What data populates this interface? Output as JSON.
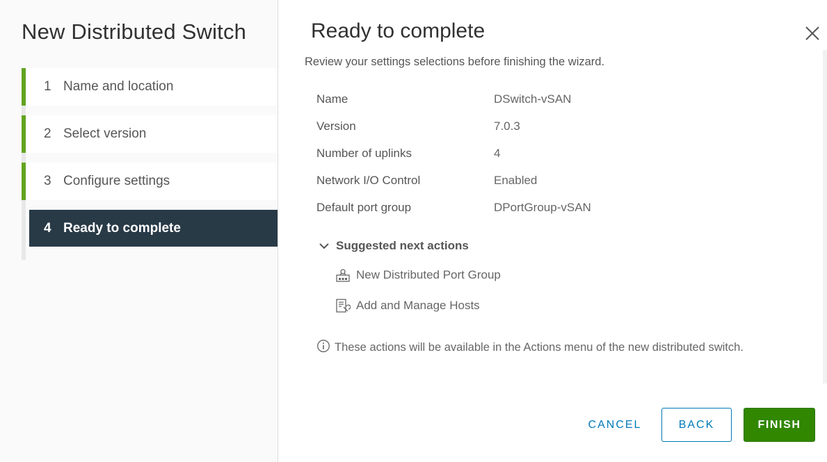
{
  "wizard": {
    "title": "New Distributed Switch",
    "steps": [
      {
        "num": "1",
        "label": "Name and location"
      },
      {
        "num": "2",
        "label": "Select version"
      },
      {
        "num": "3",
        "label": "Configure settings"
      },
      {
        "num": "4",
        "label": "Ready to complete"
      }
    ]
  },
  "page": {
    "title": "Ready to complete",
    "subtitle": "Review your settings selections before finishing the wizard."
  },
  "summary": [
    {
      "key": "Name",
      "value": "DSwitch-vSAN"
    },
    {
      "key": "Version",
      "value": "7.0.3"
    },
    {
      "key": "Number of uplinks",
      "value": "4"
    },
    {
      "key": "Network I/O Control",
      "value": "Enabled"
    },
    {
      "key": "Default port group",
      "value": "DPortGroup-vSAN"
    }
  ],
  "next_actions": {
    "label": "Suggested next actions",
    "items": [
      {
        "label": "New Distributed Port Group",
        "icon": "port-group-icon"
      },
      {
        "label": "Add and Manage Hosts",
        "icon": "manage-hosts-icon"
      }
    ],
    "info": "These actions will be available in the Actions menu of the new distributed switch."
  },
  "buttons": {
    "cancel": "CANCEL",
    "back": "BACK",
    "finish": "FINISH"
  },
  "colors": {
    "accent_green": "#62a420",
    "active_step_bg": "#293a47",
    "link_blue": "#0079b8",
    "finish_green": "#318700"
  }
}
